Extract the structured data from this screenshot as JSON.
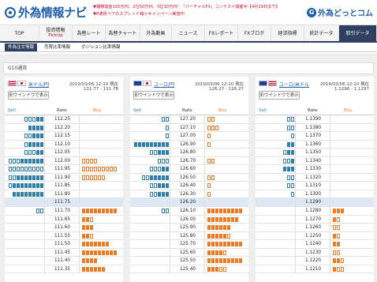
{
  "header": {
    "logo_text": "外為情報ナビ",
    "notices": [
      "▼優勝賞金100万円、2位50万円、3位30万円！「バーチャルFX」コンテスト開催中【4月19日まで】",
      "▼0通貨ペアのスプレッド縮小キャンペーン実施中"
    ],
    "brand": "外為どっとコム"
  },
  "nav": [
    {
      "label": "TOP",
      "sub": ""
    },
    {
      "label": "投資情報",
      "sub": "PickUp"
    },
    {
      "label": "為替レート",
      "sub": ""
    },
    {
      "label": "為替チャート",
      "sub": ""
    },
    {
      "label": "外為動画",
      "sub": ""
    },
    {
      "label": "ニュース",
      "sub": ""
    },
    {
      "label": "FXレポート",
      "sub": ""
    },
    {
      "label": "FXブログ",
      "sub": ""
    },
    {
      "label": "経済指標",
      "sub": ""
    },
    {
      "label": "統計データ",
      "sub": ""
    },
    {
      "label": "取引データ",
      "sub": ""
    }
  ],
  "subnav": [
    "外為注文情報",
    "売買比率情報",
    "ポジション比率情報"
  ],
  "section_title": "G10通貨",
  "headers": {
    "sell": "Sell",
    "rate": "Rate",
    "buy": "Buy"
  },
  "window_button": "別ウインドウで表示",
  "colors": {
    "sell": "#2d7fb0",
    "buy": "#ee7a22",
    "nav_active": "#2f3f5f"
  },
  "panels": [
    {
      "pair": "米ドル/円",
      "time": "2019/03/06 12:10 現在",
      "bid_ask": "111.77 - 111.78",
      "flags": [
        "us-flag",
        "jp-flag"
      ],
      "current_index": 11,
      "rows": [
        {
          "rate": "112.25",
          "sell": 2,
          "sell_o": 3,
          "buy": 0,
          "buy_o": 0
        },
        {
          "rate": "112.20",
          "sell": 4,
          "sell_o": 0,
          "buy": 0,
          "buy_o": 0
        },
        {
          "rate": "112.15",
          "sell": 3,
          "sell_o": 2,
          "buy": 0,
          "buy_o": 0
        },
        {
          "rate": "112.10",
          "sell": 4,
          "sell_o": 1,
          "buy": 0,
          "buy_o": 0
        },
        {
          "rate": "112.05",
          "sell": 2,
          "sell_o": 3,
          "buy": 0,
          "buy_o": 0
        },
        {
          "rate": "112.00",
          "sell": 6,
          "sell_o": 3,
          "buy": 0,
          "buy_o": 4
        },
        {
          "rate": "111.95",
          "sell": 0,
          "sell_o": 9,
          "buy": 0,
          "buy_o": 9
        },
        {
          "rate": "111.90",
          "sell": 7,
          "sell_o": 2,
          "buy": 0,
          "buy_o": 6
        },
        {
          "rate": "111.85",
          "sell": 8,
          "sell_o": 1,
          "buy": 0,
          "buy_o": 0
        },
        {
          "rate": "111.80",
          "sell": 8,
          "sell_o": 0,
          "buy": 0,
          "buy_o": 0
        },
        {
          "rate": "111.75",
          "sell": 0,
          "sell_o": 0,
          "buy": 0,
          "buy_o": 0
        },
        {
          "rate": "111.70",
          "sell": 0,
          "sell_o": 2,
          "buy": 9,
          "buy_o": 0
        },
        {
          "rate": "111.65",
          "sell": 0,
          "sell_o": 0,
          "buy": 2,
          "buy_o": 1
        },
        {
          "rate": "111.60",
          "sell": 0,
          "sell_o": 0,
          "buy": 3,
          "buy_o": 0
        },
        {
          "rate": "111.55",
          "sell": 0,
          "sell_o": 0,
          "buy": 2,
          "buy_o": 1
        },
        {
          "rate": "111.50",
          "sell": 0,
          "sell_o": 0,
          "buy": 7,
          "buy_o": 0
        },
        {
          "rate": "111.45",
          "sell": 0,
          "sell_o": 0,
          "buy": 9,
          "buy_o": 0
        },
        {
          "rate": "111.40",
          "sell": 0,
          "sell_o": 0,
          "buy": 4,
          "buy_o": 0
        },
        {
          "rate": "111.35",
          "sell": 0,
          "sell_o": 0,
          "buy": 6,
          "buy_o": 0
        }
      ]
    },
    {
      "pair": "ユーロ/円",
      "time": "2019/03/06 12:10 現在",
      "bid_ask": "126.27 - 126.27",
      "flags": [
        "eu-flag",
        "jp-flag"
      ],
      "current_index": 11,
      "rows": [
        {
          "rate": "127.20",
          "sell": 0,
          "sell_o": 2,
          "buy": 0,
          "buy_o": 2
        },
        {
          "rate": "127.10",
          "sell": 0,
          "sell_o": 1,
          "buy": 0,
          "buy_o": 3
        },
        {
          "rate": "127.00",
          "sell": 0,
          "sell_o": 1,
          "buy": 0,
          "buy_o": 1
        },
        {
          "rate": "126.90",
          "sell": 9,
          "sell_o": 0,
          "buy": 0,
          "buy_o": 1
        },
        {
          "rate": "126.80",
          "sell": 3,
          "sell_o": 2,
          "buy": 0,
          "buy_o": 0
        },
        {
          "rate": "126.70",
          "sell": 0,
          "sell_o": 3,
          "buy": 0,
          "buy_o": 2
        },
        {
          "rate": "126.60",
          "sell": 2,
          "sell_o": 3,
          "buy": 0,
          "buy_o": 0
        },
        {
          "rate": "126.50",
          "sell": 5,
          "sell_o": 2,
          "buy": 0,
          "buy_o": 2
        },
        {
          "rate": "126.40",
          "sell": 3,
          "sell_o": 2,
          "buy": 0,
          "buy_o": 1
        },
        {
          "rate": "126.30",
          "sell": 3,
          "sell_o": 2,
          "buy": 0,
          "buy_o": 1
        },
        {
          "rate": "126.20",
          "sell": 0,
          "sell_o": 0,
          "buy": 0,
          "buy_o": 0
        },
        {
          "rate": "126.10",
          "sell": 0,
          "sell_o": 2,
          "buy": 9,
          "buy_o": 0
        },
        {
          "rate": "126.00",
          "sell": 0,
          "sell_o": 0,
          "buy": 8,
          "buy_o": 0
        },
        {
          "rate": "125.90",
          "sell": 0,
          "sell_o": 0,
          "buy": 6,
          "buy_o": 0
        },
        {
          "rate": "125.80",
          "sell": 0,
          "sell_o": 0,
          "buy": 5,
          "buy_o": 1
        },
        {
          "rate": "125.70",
          "sell": 0,
          "sell_o": 0,
          "buy": 9,
          "buy_o": 0
        },
        {
          "rate": "125.60",
          "sell": 0,
          "sell_o": 0,
          "buy": 4,
          "buy_o": 1
        },
        {
          "rate": "125.50",
          "sell": 0,
          "sell_o": 0,
          "buy": 9,
          "buy_o": 0
        },
        {
          "rate": "125.40",
          "sell": 0,
          "sell_o": 0,
          "buy": 3,
          "buy_o": 2
        }
      ]
    },
    {
      "pair": "ユーロ/米ドル",
      "time": "2019/03/06 12:10 現在",
      "bid_ask": "1.1296 - 1.1297",
      "flags": [
        "eu-flag",
        "us-flag"
      ],
      "current_index": 11,
      "rows": [
        {
          "rate": "1.1390",
          "sell": 0,
          "sell_o": 2,
          "buy": 0,
          "buy_o": 0
        },
        {
          "rate": "1.1380",
          "sell": 0,
          "sell_o": 2,
          "buy": 0,
          "buy_o": 0
        },
        {
          "rate": "1.1370",
          "sell": 0,
          "sell_o": 1,
          "buy": 0,
          "buy_o": 0
        },
        {
          "rate": "1.1360",
          "sell": 2,
          "sell_o": 0,
          "buy": 0,
          "buy_o": 0
        },
        {
          "rate": "1.1350",
          "sell": 2,
          "sell_o": 1,
          "buy": 0,
          "buy_o": 0
        },
        {
          "rate": "1.1340",
          "sell": 1,
          "sell_o": 2,
          "buy": 0,
          "buy_o": 0
        },
        {
          "rate": "1.1330",
          "sell": 3,
          "sell_o": 0,
          "buy": 0,
          "buy_o": 0
        },
        {
          "rate": "1.1320",
          "sell": 0,
          "sell_o": 2,
          "buy": 0,
          "buy_o": 0
        },
        {
          "rate": "1.1310",
          "sell": 0,
          "sell_o": 2,
          "buy": 0,
          "buy_o": 0
        },
        {
          "rate": "1.1300",
          "sell": 0,
          "sell_o": 1,
          "buy": 0,
          "buy_o": 0
        },
        {
          "rate": "1.1290",
          "sell": 0,
          "sell_o": 0,
          "buy": 0,
          "buy_o": 0
        },
        {
          "rate": "1.1280",
          "sell": 0,
          "sell_o": 0,
          "buy": 3,
          "buy_o": 0
        },
        {
          "rate": "1.1270",
          "sell": 0,
          "sell_o": 0,
          "buy": 1,
          "buy_o": 1
        },
        {
          "rate": "1.1260",
          "sell": 0,
          "sell_o": 0,
          "buy": 0,
          "buy_o": 2
        },
        {
          "rate": "1.1250",
          "sell": 0,
          "sell_o": 0,
          "buy": 1,
          "buy_o": 1
        },
        {
          "rate": "1.1240",
          "sell": 0,
          "sell_o": 0,
          "buy": 2,
          "buy_o": 0
        },
        {
          "rate": "1.1230",
          "sell": 0,
          "sell_o": 0,
          "buy": 0,
          "buy_o": 2
        },
        {
          "rate": "1.1220",
          "sell": 0,
          "sell_o": 0,
          "buy": 2,
          "buy_o": 1
        },
        {
          "rate": "1.1210",
          "sell": 0,
          "sell_o": 0,
          "buy": 1,
          "buy_o": 2
        }
      ]
    }
  ]
}
